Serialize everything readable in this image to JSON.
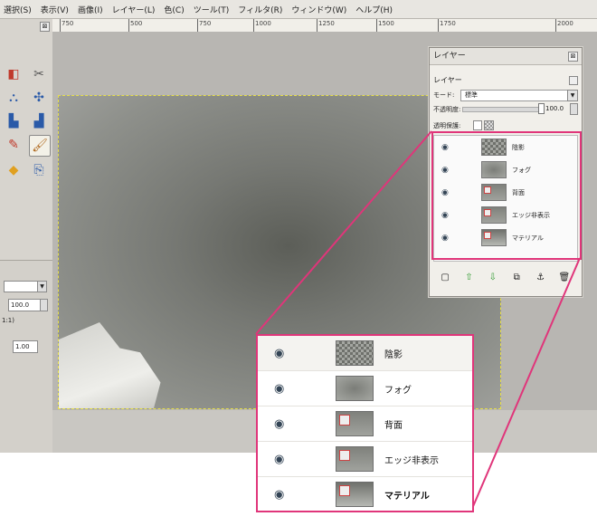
{
  "menu": [
    "選択(S)",
    "表示(V)",
    "画像(I)",
    "レイヤー(L)",
    "色(C)",
    "ツール(T)",
    "フィルタ(R)",
    "ウィンドウ(W)",
    "ヘルプ(H)"
  ],
  "ruler": {
    "ticks": [
      "750",
      "500",
      "750",
      "1000",
      "1250",
      "1500",
      "1750",
      "2000"
    ]
  },
  "toolbox": {
    "close_glyph": "⊠",
    "tools": [
      {
        "icon": "color-picker-icon",
        "glyph": "◧"
      },
      {
        "icon": "scissors-icon",
        "glyph": "✂"
      },
      {
        "icon": "bucket-fill-icon",
        "glyph": "⛬"
      },
      {
        "icon": "move-icon",
        "glyph": "✣"
      },
      {
        "icon": "blur-icon",
        "glyph": "▙"
      },
      {
        "icon": "smudge-icon",
        "glyph": "▟"
      },
      {
        "icon": "pencil-icon",
        "glyph": "✎"
      },
      {
        "icon": "paintbrush-icon",
        "glyph": "🖌"
      },
      {
        "icon": "eraser-icon",
        "glyph": "◆"
      },
      {
        "icon": "clone-icon",
        "glyph": "⎘"
      }
    ],
    "options": {
      "scale_value": "100.0",
      "ratio_text": "1:1)",
      "size_value": "1.00"
    }
  },
  "layers_panel": {
    "title": "レイヤー",
    "subtitle": "レイヤー",
    "mode_label": "モード:",
    "mode_value": "標準",
    "opacity_label": "不透明度:",
    "opacity_value": "100.0",
    "lock_label": "透明保護:",
    "close_glyph": "⊠",
    "layers": [
      {
        "name": "陰影",
        "visible": true,
        "thumb": "checker"
      },
      {
        "name": "フォグ",
        "visible": true,
        "thumb": "fog"
      },
      {
        "name": "背面",
        "visible": true,
        "thumb": "icon"
      },
      {
        "name": "エッジ非表示",
        "visible": true,
        "thumb": "icon"
      },
      {
        "name": "マテリアル",
        "visible": true,
        "thumb": "mat"
      }
    ],
    "footer_icons": [
      {
        "icon": "new-layer-icon",
        "glyph": "▢"
      },
      {
        "icon": "raise-layer-icon",
        "glyph": "⇧"
      },
      {
        "icon": "lower-layer-icon",
        "glyph": "⇩"
      },
      {
        "icon": "duplicate-layer-icon",
        "glyph": "⧉"
      },
      {
        "icon": "anchor-layer-icon",
        "glyph": "⚓"
      },
      {
        "icon": "delete-layer-icon",
        "glyph": "🗑"
      }
    ]
  },
  "zoom": {
    "layers": [
      {
        "name": "陰影",
        "thumb": "checker"
      },
      {
        "name": "フォグ",
        "thumb": "fog"
      },
      {
        "name": "背面",
        "thumb": "icon"
      },
      {
        "name": "エッジ非表示",
        "thumb": "icon"
      },
      {
        "name": "マテリアル",
        "thumb": "mat",
        "bold": true
      }
    ]
  },
  "glyphs": {
    "eye": "◉",
    "dropdown": "▼"
  },
  "colors": {
    "highlight": "#e0357a",
    "selection_marquee": "#e8e04a"
  }
}
